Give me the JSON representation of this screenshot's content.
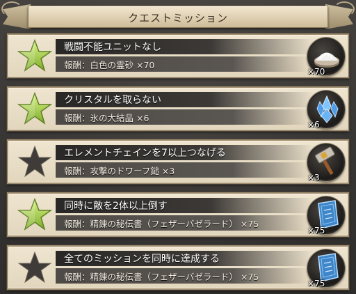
{
  "header": {
    "title": "クエストミッション"
  },
  "missions": [
    {
      "name": "戦闘不能ユニットなし",
      "reward": "報酬：白色の霊砂 ×70",
      "count": "×70",
      "completed": true,
      "icon": "white-sand-icon"
    },
    {
      "name": "クリスタルを取らない",
      "reward": "報酬：氷の大結晶 ×6",
      "count": "×6",
      "completed": true,
      "icon": "ice-crystal-icon"
    },
    {
      "name": "エレメントチェインを7以上つなげる",
      "reward": "報酬：攻撃のドワーフ鎚 ×3",
      "count": "×3",
      "completed": false,
      "icon": "dwarf-hammer-icon"
    },
    {
      "name": "同時に敵を2体以上倒す",
      "reward": "報酬：精錬の秘伝書（フェザーバゼラード） ×75",
      "count": "×75",
      "completed": true,
      "icon": "secret-book-icon"
    },
    {
      "name": "全てのミッションを同時に達成する",
      "reward": "報酬：精錬の秘伝書（フェザーバゼラード） ×75",
      "count": "×75",
      "completed": false,
      "icon": "secret-book-icon"
    }
  ],
  "colors": {
    "star_complete": "#a9d24a",
    "star_incomplete": "#3a3836",
    "panel": "#e8dcc3"
  }
}
